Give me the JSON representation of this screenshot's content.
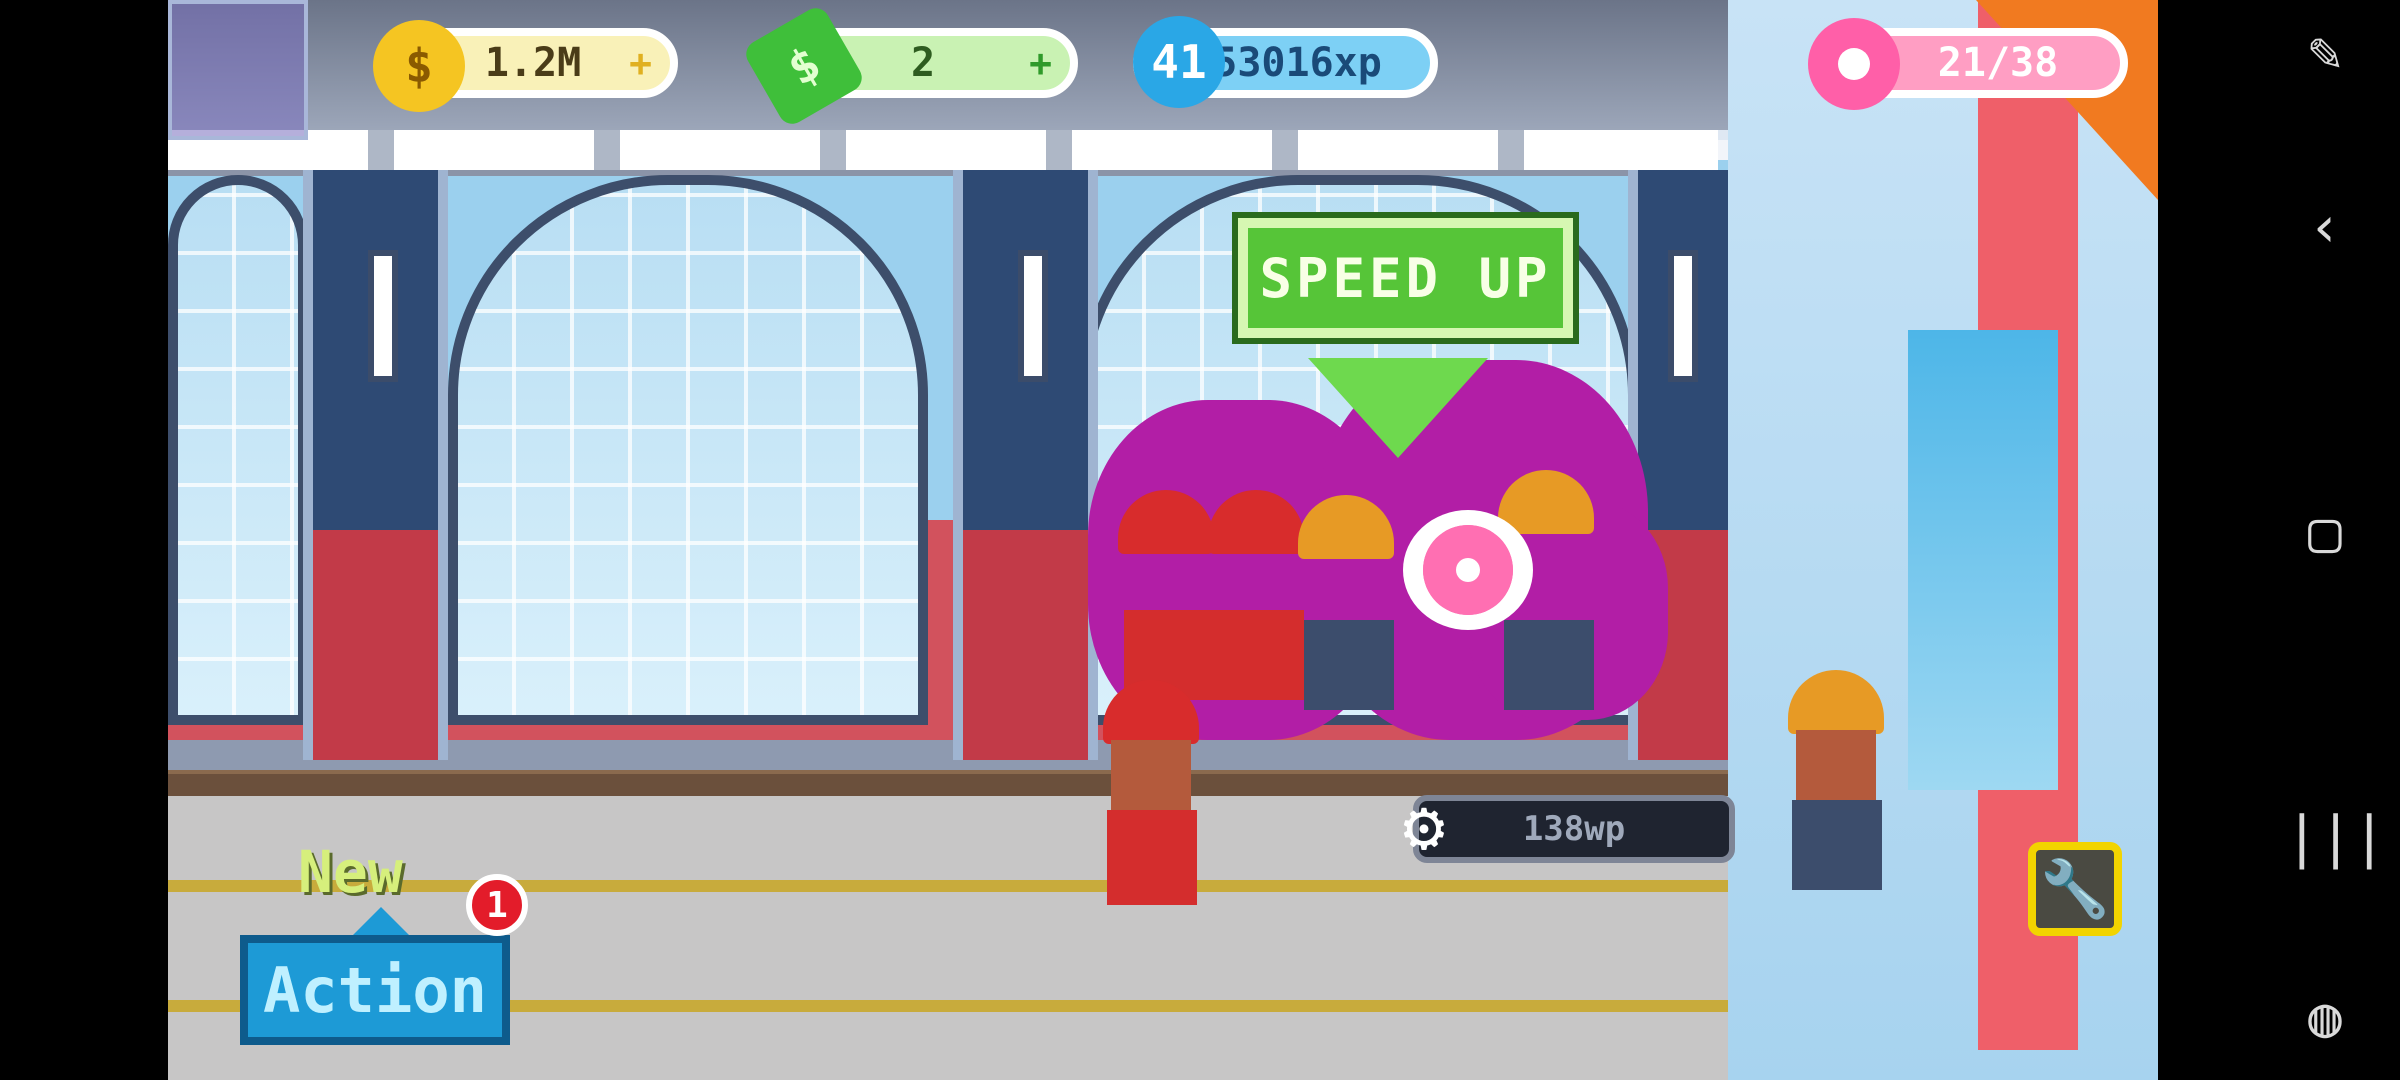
{
  "hud": {
    "coins": "1.2M",
    "cash": "2",
    "level": "41",
    "xp": "453016xp",
    "donuts": "21/38"
  },
  "speed_up_label": "SPEED UP",
  "progress_label": "138wp",
  "new_label": "New",
  "action_label": "Action",
  "action_badge": "1",
  "colors": {
    "coin": "#f5c522",
    "cash": "#3fbf3a",
    "xp": "#2aa7e6",
    "donut": "#ff5fa8",
    "smoke": "#b21ea6"
  },
  "nav": {
    "back_icon": "chevron-left-icon",
    "home_icon": "square-home-icon",
    "recents_icon": "recents-icon",
    "game_icon": "gamepad-icon",
    "screenshot_icon": "screen-edit-icon"
  }
}
